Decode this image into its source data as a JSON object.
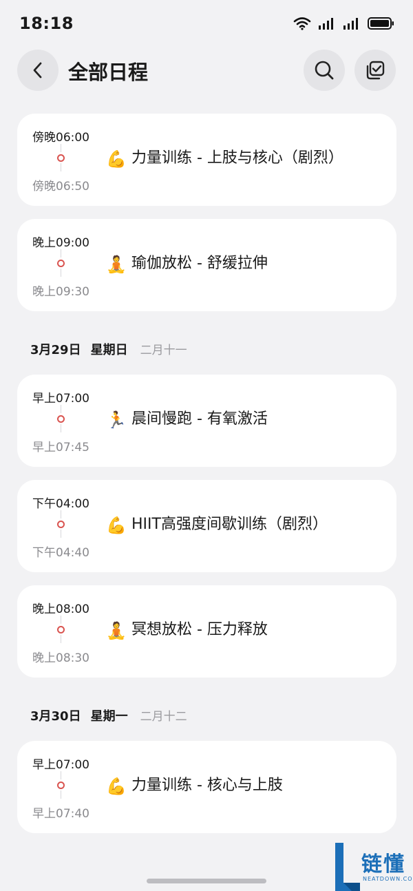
{
  "status_bar": {
    "time": "18:18",
    "icons": [
      "wifi-icon",
      "signal-icon",
      "signal-icon",
      "battery-icon"
    ]
  },
  "header": {
    "title": "全部日程",
    "back_icon": "back-icon",
    "search_icon": "search-icon",
    "select_icon": "multi-select-icon"
  },
  "colors": {
    "background": "#f2f2f4",
    "card": "#ffffff",
    "timeline_dot": "#d9534f",
    "watermark": "#1c6fb8"
  },
  "events_today": [
    {
      "start": "傍晚06:00",
      "end": "傍晚06:50",
      "emoji": "💪",
      "title": "力量训练 - 上肢与核心（剧烈）"
    },
    {
      "start": "晚上09:00",
      "end": "晚上09:30",
      "emoji": "🧘",
      "title": "瑜伽放松 - 舒缓拉伸"
    }
  ],
  "day_29": {
    "date": "3月29日",
    "weekday": "星期日",
    "lunar": "二月十一",
    "events": [
      {
        "start": "早上07:00",
        "end": "早上07:45",
        "emoji": "🏃",
        "title": "晨间慢跑 - 有氧激活"
      },
      {
        "start": "下午04:00",
        "end": "下午04:40",
        "emoji": "💪",
        "title": "HIIT高强度间歇训练（剧烈）"
      },
      {
        "start": "晚上08:00",
        "end": "晚上08:30",
        "emoji": "🧘",
        "title": "冥想放松 - 压力释放"
      }
    ]
  },
  "day_30": {
    "date": "3月30日",
    "weekday": "星期一",
    "lunar": "二月十二",
    "events": [
      {
        "start": "早上07:00",
        "end": "早上07:40",
        "emoji": "💪",
        "title": "力量训练 - 核心与上肢"
      }
    ]
  },
  "watermark": {
    "text": "链懂",
    "sub": "NEATDOWN.COM"
  }
}
